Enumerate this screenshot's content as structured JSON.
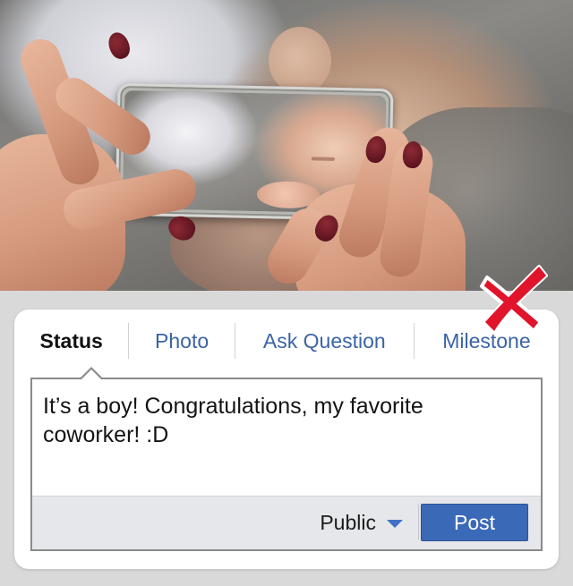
{
  "photo": {
    "alt_name": "hands-holding-phone-photo"
  },
  "tabs": [
    {
      "label": "Status",
      "active": true
    },
    {
      "label": "Photo",
      "active": false
    },
    {
      "label": "Ask Question",
      "active": false
    },
    {
      "label": "Milestone",
      "active": false
    }
  ],
  "composer": {
    "text": "It’s a boy! Congratulations, my favorite coworker! :D"
  },
  "footer": {
    "privacy_label": "Public",
    "post_label": "Post"
  },
  "colors": {
    "link_blue": "#3b64a6",
    "post_button": "#3a69b8",
    "x_mark_red": "#e0142b"
  },
  "annotations": {
    "x_mark_icon": "red-x-icon"
  }
}
